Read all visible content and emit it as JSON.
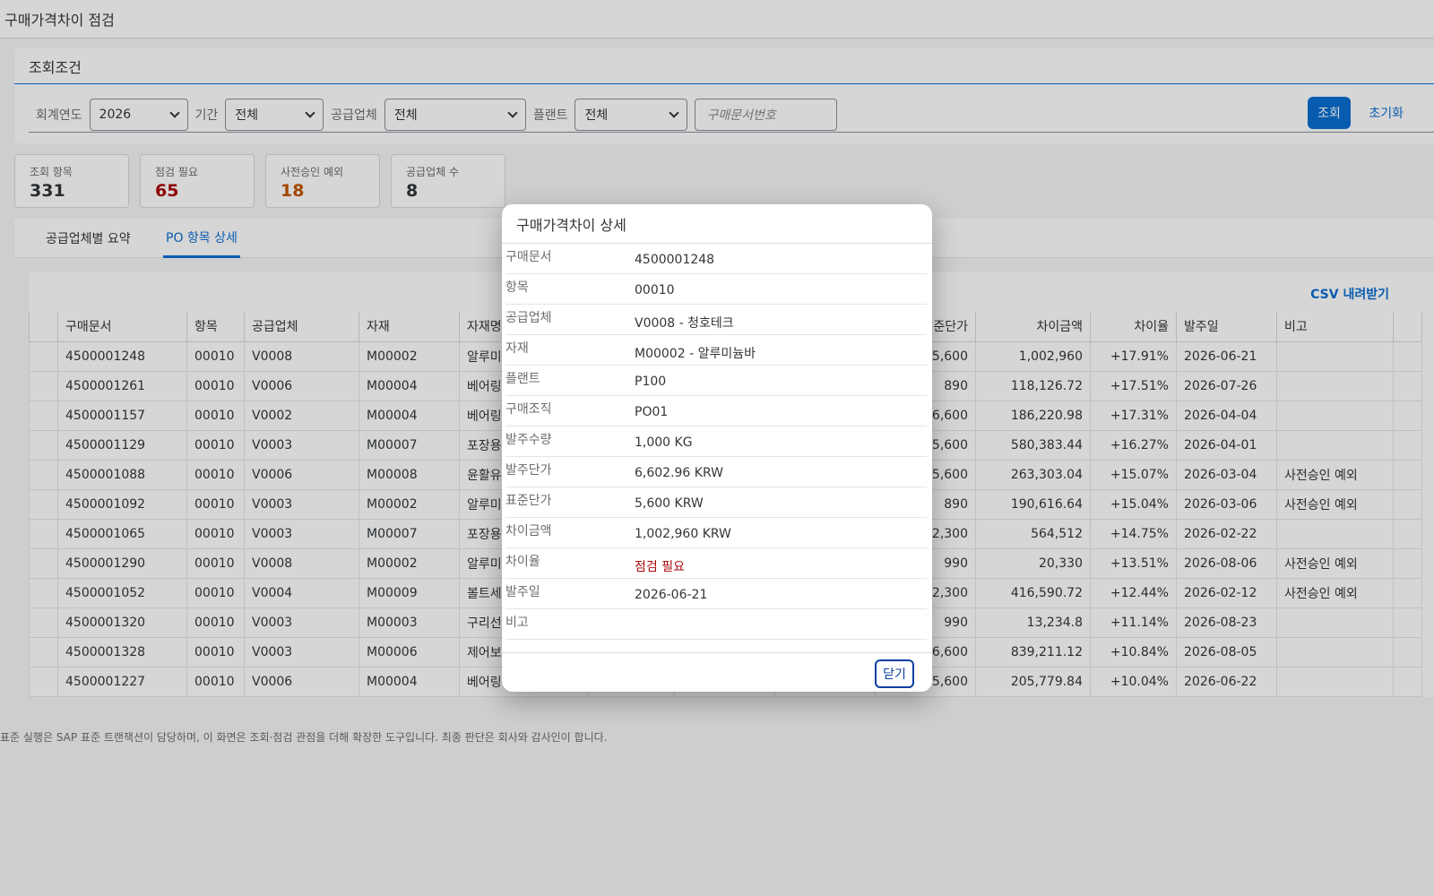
{
  "app": {
    "title": "구매가격차이 점검"
  },
  "filters": {
    "heading": "조회조건",
    "fiscal_year_label": "회계연도",
    "fiscal_year_value": "2026",
    "period_label": "기간",
    "period_value": "전체",
    "vendor_label": "공급업체",
    "vendor_value": "전체",
    "plant_label": "플랜트",
    "plant_value": "전체",
    "po_placeholder": "구매문서번호",
    "search_label": "조회",
    "reset_label": "초기화"
  },
  "kpis": [
    {
      "label": "조회 항목",
      "value": "331",
      "color": "#32363a"
    },
    {
      "label": "점검 필요",
      "value": "65",
      "color": "#aa0808"
    },
    {
      "label": "사전승인 예외",
      "value": "18",
      "color": "#c35500"
    },
    {
      "label": "공급업체 수",
      "value": "8",
      "color": "#32363a"
    }
  ],
  "tabs": [
    {
      "label": "공급업체별 요약"
    },
    {
      "label": "PO 항목 상세"
    }
  ],
  "table": {
    "csv_label": "CSV 내려받기",
    "headers": [
      "구매문서",
      "항목",
      "공급업체",
      "자재",
      "자재명",
      "",
      "",
      "",
      "준단가",
      "차이금액",
      "차이율",
      "발주일",
      "비고"
    ],
    "rows": [
      [
        "4500001248",
        "00010",
        "V0008",
        "M00002",
        "알루미",
        "5,600",
        "1,002,960",
        "+17.91%",
        "2026-06-21",
        ""
      ],
      [
        "4500001261",
        "00010",
        "V0006",
        "M00004",
        "베어링",
        "890",
        "118,126.72",
        "+17.51%",
        "2026-07-26",
        ""
      ],
      [
        "4500001157",
        "00010",
        "V0002",
        "M00004",
        "베어링",
        "6,600",
        "186,220.98",
        "+17.31%",
        "2026-04-04",
        ""
      ],
      [
        "4500001129",
        "00010",
        "V0003",
        "M00007",
        "포장용",
        "5,600",
        "580,383.44",
        "+16.27%",
        "2026-04-01",
        ""
      ],
      [
        "4500001088",
        "00010",
        "V0006",
        "M00008",
        "윤활유",
        "5,600",
        "263,303.04",
        "+15.07%",
        "2026-03-04",
        "사전승인 예외"
      ],
      [
        "4500001092",
        "00010",
        "V0003",
        "M00002",
        "알루미",
        "890",
        "190,616.64",
        "+15.04%",
        "2026-03-06",
        "사전승인 예외"
      ],
      [
        "4500001065",
        "00010",
        "V0003",
        "M00007",
        "포장용",
        "2,300",
        "564,512",
        "+14.75%",
        "2026-02-22",
        ""
      ],
      [
        "4500001290",
        "00010",
        "V0008",
        "M00002",
        "알루미",
        "990",
        "20,330",
        "+13.51%",
        "2026-08-06",
        "사전승인 예외"
      ],
      [
        "4500001052",
        "00010",
        "V0004",
        "M00009",
        "볼트세",
        "2,300",
        "416,590.72",
        "+12.44%",
        "2026-02-12",
        "사전승인 예외"
      ],
      [
        "4500001320",
        "00010",
        "V0003",
        "M00003",
        "구리선",
        "990",
        "13,234.8",
        "+11.14%",
        "2026-08-23",
        ""
      ],
      [
        "4500001328",
        "00010",
        "V0003",
        "M00006",
        "제어보",
        "6,600",
        "839,211.12",
        "+10.84%",
        "2026-08-05",
        ""
      ],
      [
        "4500001227",
        "00010",
        "V0006",
        "M00004",
        "베어링",
        "5,600",
        "205,779.84",
        "+10.04%",
        "2026-06-22",
        ""
      ]
    ]
  },
  "footer_note": "표준 실행은 SAP 표준 트랜잭션이 담당하며, 이 화면은 조회·점검 관점을 더해 확장한 도구입니다. 최종 판단은 회사와 감사인이 합니다.",
  "dialog": {
    "title": "구매가격차이 상세",
    "fields": [
      {
        "key": "구매문서",
        "value": "4500001248"
      },
      {
        "key": "항목",
        "value": "00010"
      },
      {
        "key": "공급업체",
        "value": "V0008 - 청호테크"
      },
      {
        "key": "자재",
        "value": "M00002 - 알루미늄바"
      },
      {
        "key": "플랜트",
        "value": "P100"
      },
      {
        "key": "구매조직",
        "value": "PO01"
      },
      {
        "key": "발주수량",
        "value": "1,000 KG"
      },
      {
        "key": "발주단가",
        "value": "6,602.96 KRW"
      },
      {
        "key": "표준단가",
        "value": "5,600 KRW"
      },
      {
        "key": "차이금액",
        "value": "1,002,960 KRW"
      },
      {
        "key": "차이율",
        "value": "점검 필요"
      },
      {
        "key": "발주일",
        "value": "2026-06-21"
      },
      {
        "key": "비고",
        "value": ""
      }
    ],
    "close_label": "닫기"
  }
}
